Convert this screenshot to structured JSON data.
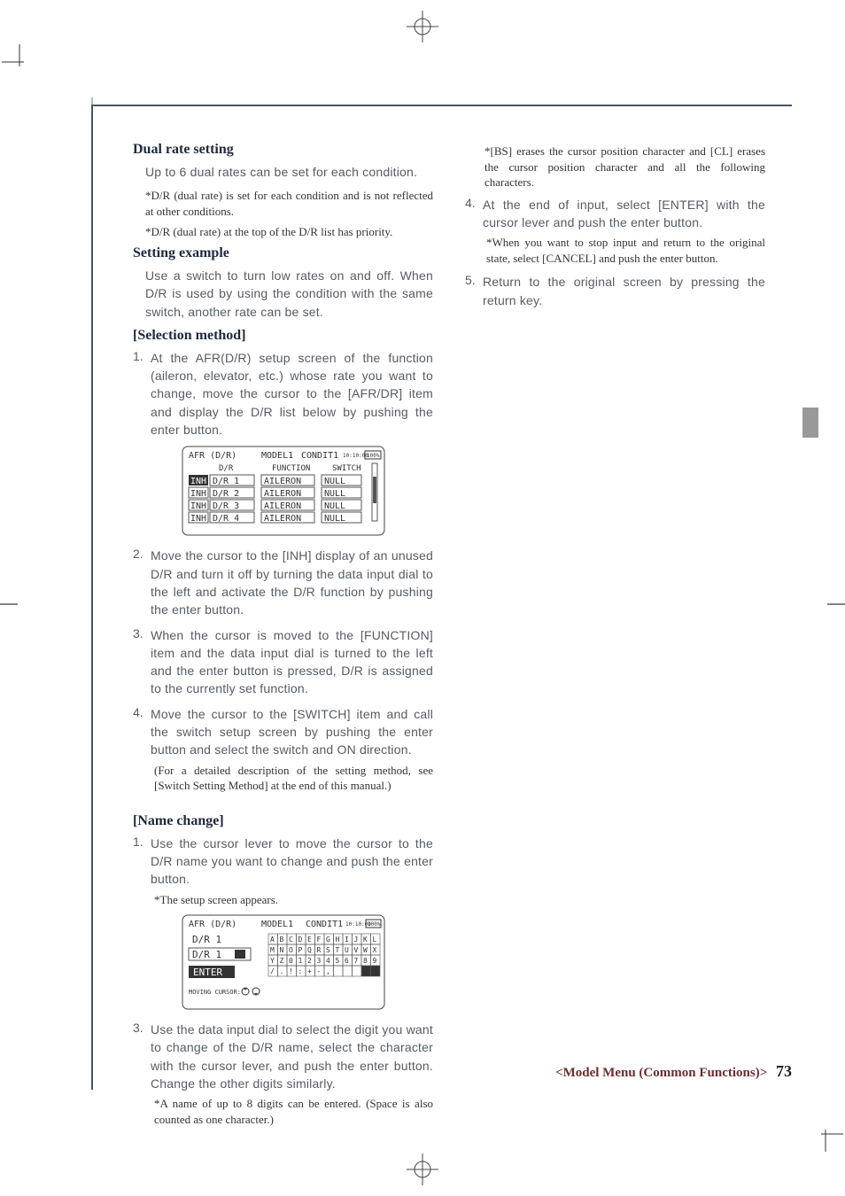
{
  "left": {
    "h_dual": "Dual rate setting",
    "dual_p1": "Up to 6 dual rates can be set for each condition.",
    "dual_note1": "*D/R (dual rate) is set for each condition and is not reflected at other conditions.",
    "dual_note2": "*D/R (dual rate) at the top of the D/R list has priority.",
    "h_setting": "Setting example",
    "setting_p1": "Use a switch to turn low rates on and off. When D/R is used by using the condition with the same switch, another rate can be set.",
    "h_selmethod": "[Selection method]",
    "sel_steps": [
      "At the AFR(D/R) setup screen of the function (aileron, elevator, etc.) whose rate you want to change, move the cursor to the [AFR/DR] item and display the D/R list below by pushing the enter button.",
      "Move the cursor to the [INH] display of an unused D/R and turn it off by turning the data input dial to the left and activate the D/R function by pushing the enter button.",
      "When the cursor is moved to the [FUNCTION] item and the data input dial is turned to the left and the enter button is pressed, D/R is assigned to the currently set function.",
      "Move the cursor to the [SWITCH] item and call the switch setup screen by pushing the enter button and select the switch and ON direction."
    ],
    "sel_subnote": "(For a detailed description of the setting method, see [Switch Setting Method] at the end of this manual.)",
    "h_name": "[Name change]",
    "name_steps_1": "Use the cursor lever to move the cursor to the D/R name you want to change and push the enter button.",
    "name_note_1": "*The setup screen appears.",
    "name_steps_3": "Use the data input dial to select the digit you want to change of the D/R name, select the  character with the cursor lever, and push the enter button. Change the other digits similarly.",
    "name_note_3": "*A name of up to 8 digits can be entered. (Space is also counted as one character.)"
  },
  "right": {
    "cont_note": "*[BS] erases the cursor position character and [CL] erases the cursor position character and all the following characters.",
    "cont_steps": [
      {
        "n": "4.",
        "t": "At the end of input, select [ENTER] with the cursor lever and push the enter button.",
        "sub": "*When you want to stop input and return to the original state, select [CANCEL] and push the enter button."
      },
      {
        "n": "5.",
        "t": "Return to the original screen by pressing the return key."
      }
    ]
  },
  "lcd1": {
    "title": "AFR (D/R)",
    "model": "MODEL1",
    "cond": "CONDIT1",
    "ts": "10:10:00",
    "batt": "100%",
    "cols": [
      "D/R",
      "FUNCTION",
      "SWITCH"
    ],
    "rows": [
      {
        "inh": "INH",
        "dr": "D/R 1",
        "func": "AILERON",
        "sw": "NULL"
      },
      {
        "inh": "INH",
        "dr": "D/R 2",
        "func": "AILERON",
        "sw": "NULL"
      },
      {
        "inh": "INH",
        "dr": "D/R 3",
        "func": "AILERON",
        "sw": "NULL"
      },
      {
        "inh": "INH",
        "dr": "D/R 4",
        "func": "AILERON",
        "sw": "NULL"
      }
    ]
  },
  "lcd2": {
    "title": "AFR (D/R)",
    "model": "MODEL1",
    "cond": "CONDIT1",
    "ts": "10:10:00",
    "batt": "100%",
    "label": "D/R 1",
    "field": "D/R 1",
    "enter": "ENTER",
    "moving": "MOVING CURSOR:",
    "grid": [
      [
        "A",
        "B",
        "C",
        "D",
        "E",
        "F",
        "G",
        "H",
        "I",
        "J",
        "K",
        "L"
      ],
      [
        "M",
        "N",
        "O",
        "P",
        "Q",
        "R",
        "S",
        "T",
        "U",
        "V",
        "W",
        "X"
      ],
      [
        "Y",
        "Z",
        "0",
        "1",
        "2",
        "3",
        "4",
        "5",
        "6",
        "7",
        "8",
        "9"
      ],
      [
        "/",
        ".",
        "!",
        ":",
        "+",
        "-",
        ",",
        "",
        " ",
        " ",
        "BS",
        "CL"
      ]
    ]
  },
  "footer": {
    "section": "<Model Menu (Common Functions)>",
    "page": "73"
  }
}
